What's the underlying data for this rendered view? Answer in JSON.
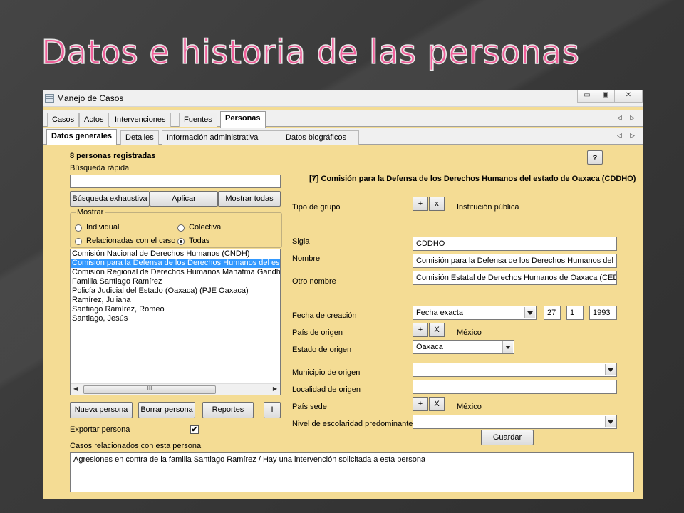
{
  "slide": {
    "title": "Datos e historia de las personas"
  },
  "window": {
    "title": "Manejo de Casos",
    "min": "▭",
    "max": "▣",
    "close": "✕"
  },
  "main_tabs": [
    "Casos",
    "Actos",
    "Intervenciones",
    "Fuentes",
    "Personas"
  ],
  "sub_tabs": [
    "Datos generales",
    "Detalles",
    "Información administrativa",
    "Datos biográficos"
  ],
  "arrows": {
    "left": "◁",
    "right": "▷"
  },
  "left": {
    "count_label": "8 personas registradas",
    "quick_search_label": "Búsqueda rápida",
    "quick_search_value": "",
    "btn_exhaustive": "Búsqueda exhaustiva",
    "btn_apply": "Aplicar",
    "btn_show_all": "Mostrar todas",
    "show_group": "Mostrar",
    "radios": {
      "individual": "Individual",
      "colectiva": "Colectiva",
      "related": "Relacionadas con el caso",
      "todas": "Todas"
    },
    "selected_radio": "Todas",
    "persons": [
      "Comisión Nacional de Derechos Humanos (CNDH)",
      "Comisión para la Defensa de los Derechos Humanos del estado",
      "Comisión Regional de Derechos Humanos Mahatma Gandhi (C",
      "Familia Santiago Ramírez",
      "Policía Judicial del Estado (Oaxaca) (PJE Oaxaca)",
      "Ramírez, Juliana",
      "Santiago Ramírez, Romeo",
      "Santiago, Jesús"
    ],
    "selected_index": 1,
    "scroll_thumb": "III",
    "btn_new": "Nueva persona",
    "btn_delete": "Borrar persona",
    "btn_reports": "Reportes",
    "btn_i": "I",
    "export_label": "Exportar persona",
    "export_checked": "✔",
    "related_cases_label": "Casos relacionados con esta persona",
    "related_cases_text": "Agresiones en contra de la familia Santiago Ramírez / Hay una intervención solicitada a esta persona"
  },
  "right": {
    "help": "?",
    "heading": "[7] Comisión para la Defensa de los Derechos Humanos del estado de Oaxaca (CDDHO)",
    "group_type_label": "Tipo de grupo",
    "plus": "+",
    "x_lower": "x",
    "x_upper": "X",
    "group_type_value": "Institución pública",
    "sigla_label": "Sigla",
    "sigla_value": "CDDHO",
    "nombre_label": "Nombre",
    "nombre_value": "Comisión para la Defensa de los Derechos Humanos del estado de Oaxaca",
    "otro_label": "Otro nombre",
    "otro_value": "Comisión Estatal de Derechos Humanos de Oaxaca (CEDH)",
    "fecha_label": "Fecha de creación",
    "fecha_type": "Fecha exacta",
    "day": "27",
    "month": "1",
    "year": "1993",
    "pais_origen_label": "País de origen",
    "pais_origen_value": "México",
    "estado_label": "Estado de origen",
    "estado_value": "Oaxaca",
    "municipio_label": "Municipio de origen",
    "municipio_value": "",
    "localidad_label": "Localidad de origen",
    "localidad_value": "",
    "pais_sede_label": "País sede",
    "pais_sede_value": "México",
    "escolaridad_label": "Nivel de escolaridad predominante",
    "escolaridad_value": "",
    "btn_save": "Guardar"
  },
  "colors": {
    "panel": "#f4dc94",
    "title": "#f0609a",
    "selection": "#3399ff"
  }
}
